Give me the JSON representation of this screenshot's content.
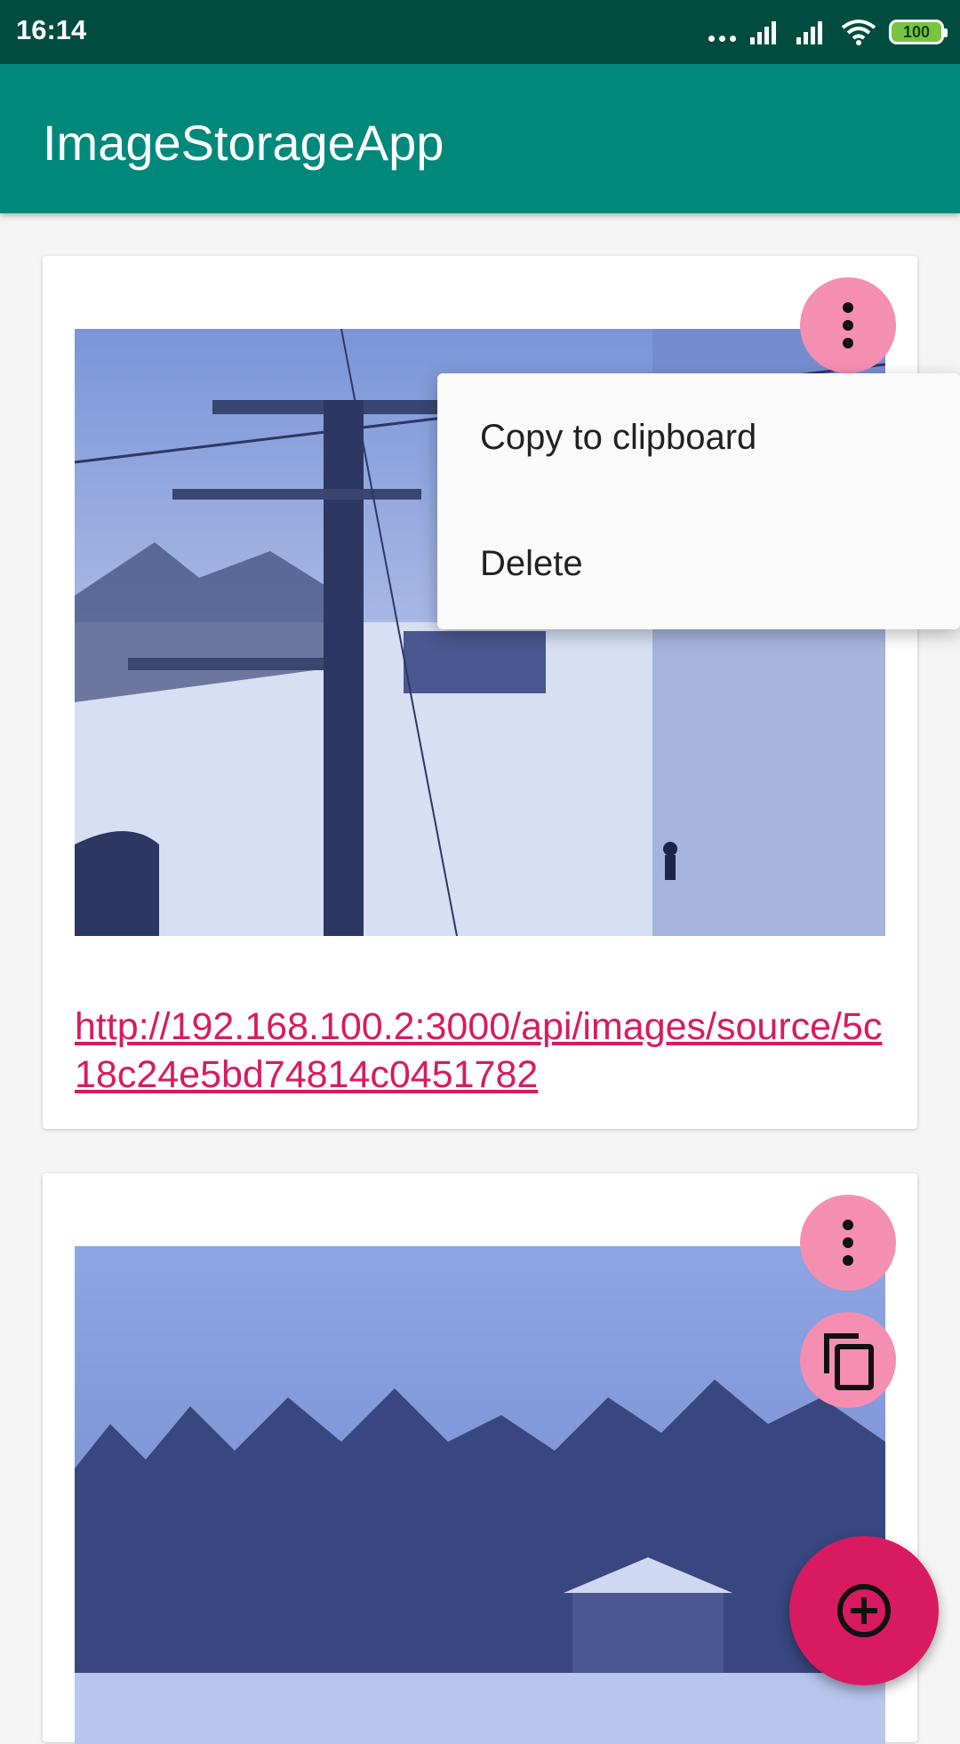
{
  "status_bar": {
    "time": "16:14",
    "battery": "100",
    "icons": [
      "dots-icon",
      "signal-icon",
      "signal-icon",
      "wifi-icon",
      "battery-icon"
    ]
  },
  "app_bar": {
    "title": "ImageStorageApp"
  },
  "cards": [
    {
      "image": "chairlift-tower-snow-photo",
      "link": "http://192.168.100.2:3000/api/images/source/5c18c24e5bd74814c0451782",
      "actions": [
        "more-vert-icon"
      ]
    },
    {
      "image": "snowy-trees-photo",
      "actions": [
        "more-vert-icon",
        "copy-icon"
      ]
    }
  ],
  "popup_menu": {
    "items": [
      {
        "label": "Copy to clipboard"
      },
      {
        "label": "Delete"
      }
    ]
  },
  "fab": {
    "icon": "add-circle-icon"
  },
  "colors": {
    "status_bar": "#004d40",
    "app_bar": "#00897b",
    "accent": "#d81b60",
    "action_button": "#f48fb1"
  }
}
